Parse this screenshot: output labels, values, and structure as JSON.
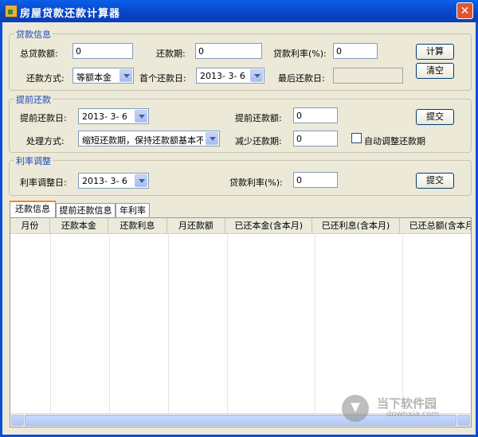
{
  "window": {
    "title": "房屋贷款还款计算器",
    "close_glyph": "✕"
  },
  "loan": {
    "legend": "贷款信息",
    "total_label": "总贷款额:",
    "total_value": "0",
    "period_label": "还款期:",
    "period_value": "0",
    "rate_label": "贷款利率(%):",
    "rate_value": "0",
    "method_label": "还款方式:",
    "method_value": "等额本金",
    "first_date_label": "首个还款日:",
    "first_date_value": "2013- 3- 6",
    "last_date_label": "最后还款日:",
    "last_date_value": "",
    "calc_button": "计算",
    "clear_button": "清空"
  },
  "prepay": {
    "legend": "提前还款",
    "date_label": "提前还款日:",
    "date_value": "2013- 3- 6",
    "amount_label": "提前还款额:",
    "amount_value": "0",
    "submit_button": "提交",
    "mode_label": "处理方式:",
    "mode_value": "缩短还款期，保持还款额基本不变",
    "reduce_label": "减少还款期:",
    "reduce_value": "0",
    "auto_adjust_label": "自动调整还款期",
    "auto_adjust_checked": false
  },
  "rate_adjust": {
    "legend": "利率调整",
    "date_label": "利率调整日:",
    "date_value": "2013- 3- 6",
    "rate_label": "贷款利率(%):",
    "rate_value": "0",
    "submit_button": "提交"
  },
  "tabs": [
    {
      "label": "还款信息",
      "active": true
    },
    {
      "label": "提前还款信息",
      "active": false
    },
    {
      "label": "年利率",
      "active": false
    }
  ],
  "table": {
    "columns": [
      "月份",
      "还款本金",
      "还款利息",
      "月还款额",
      "已还本金(含本月)",
      "已还利息(含本月)",
      "已还总额(含本月)"
    ],
    "rows": []
  },
  "watermark": {
    "brand": "当下软件园",
    "site": "downxia.com"
  },
  "colors": {
    "title_bar": "#0a4fd8",
    "legend_text": "#1c48b8",
    "tab_accent": "#e68b2c"
  }
}
